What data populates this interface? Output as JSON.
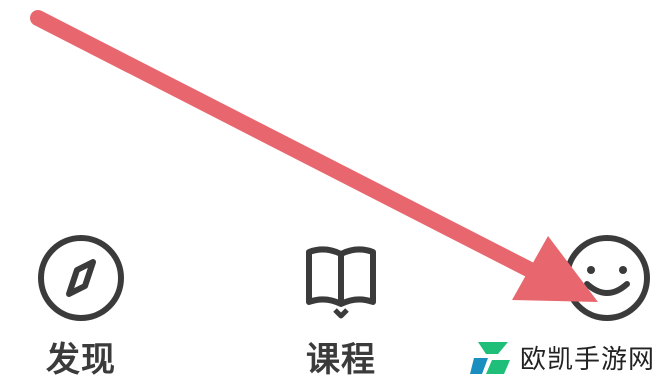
{
  "colors": {
    "icon_stroke": "#3b3b3b",
    "arrow": "#e8676f",
    "watermark_green": "#1fbf7a",
    "watermark_teal": "#1a8fbf"
  },
  "tabs": [
    {
      "label": "发现",
      "icon": "compass-icon"
    },
    {
      "label": "课程",
      "icon": "book-icon"
    },
    {
      "label": "",
      "icon": "smiley-face-icon"
    }
  ],
  "watermark": {
    "text": "欧凯手游网"
  }
}
